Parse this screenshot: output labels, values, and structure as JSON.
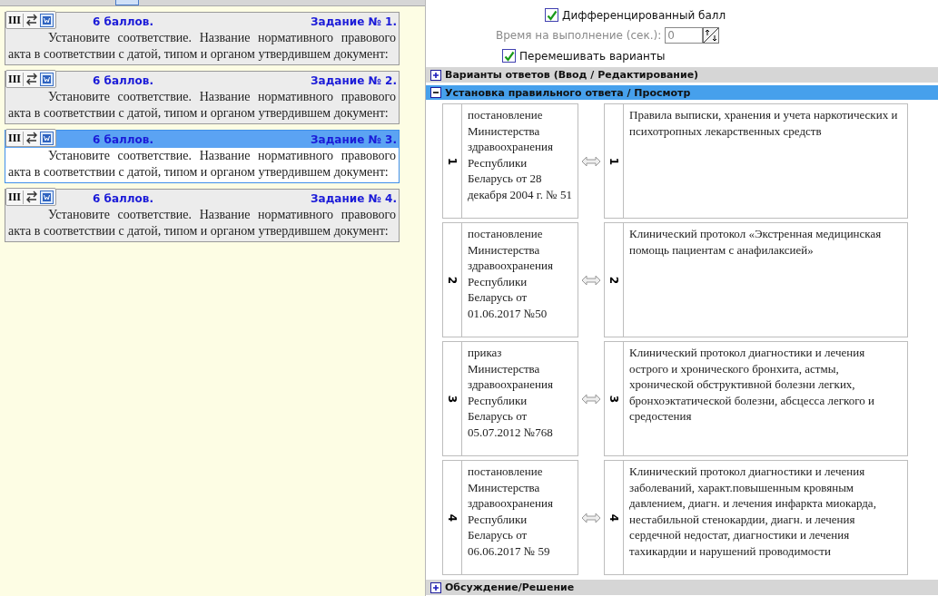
{
  "tasks": [
    {
      "tool_label": "III",
      "points": "6 баллов.",
      "title": "Задание № 1.",
      "text": "Установите соответствие. Название нормативного правового акта в соответствии с датой, типом и органом утвердившем документ:",
      "selected": false
    },
    {
      "tool_label": "III",
      "points": "6 баллов.",
      "title": "Задание № 2.",
      "text": "Установите соответствие. Название нормативного правового акта в соответствии с датой, типом и органом утвердившем документ:",
      "selected": false
    },
    {
      "tool_label": "III",
      "points": "6 баллов.",
      "title": "Задание № 3.",
      "text": "Установите соответствие. Название нормативного правового акта в соответствии с датой, типом и органом утвердившем документ:",
      "selected": true
    },
    {
      "tool_label": "III",
      "points": "6 баллов.",
      "title": "Задание № 4.",
      "text": "Установите соответствие. Название нормативного правового акта в соответствии с датой, типом и органом утвердившем документ:",
      "selected": false
    }
  ],
  "settings": {
    "differentiated": {
      "label": "Дифференцированный балл",
      "checked": true
    },
    "time": {
      "label": "Время на выполнение (сек.):",
      "value": "0"
    },
    "shuffle": {
      "label": "Перемешивать варианты",
      "checked": true
    }
  },
  "sections": [
    {
      "label": "Варианты ответов (Ввод / Редактирование)",
      "expanded": false,
      "selected": false
    },
    {
      "label": "Установка правильного ответа / Просмотр",
      "expanded": true,
      "selected": true,
      "pairs": [
        {
          "left_number": "1",
          "left": "постановление Министерства здравоохранения Республики Беларусь от 28 декабря 2004 г. № 51",
          "right_number": "1",
          "right": "Правила выписки, хранения и учета наркотических и психотропных лекарственных средств"
        },
        {
          "left_number": "2",
          "left": "постановление Министерства здравоохранения Республики Беларусь от 01.06.2017 №50",
          "right_number": "2",
          "right": "Клинический протокол «Экстренная медицинская помощь пациентам с анафилаксией»"
        },
        {
          "left_number": "3",
          "left": "приказ Министерства здравоохранения Республики Беларусь от 05.07.2012 №768",
          "right_number": "3",
          "right": "Клинический протокол диагностики и лечения острого и хронического бронхита, астмы, хронической обструктивной болезни легких, бронхоэктатической болезни, абсцесса легкого и средостения"
        },
        {
          "left_number": "4",
          "left": "постановление Министерства здравоохранения Республики Беларусь от 06.06.2017 № 59",
          "right_number": "4",
          "right": "Клинический протокол диагностики и лечения заболеваний, характ.повышенным кровяным давлением, диагн. и лечения инфаркта миокарда, нестабильной стенокардии, диагн. и лечения сердечной недостат, диагностики и лечения тахикардии и нарушений проводимости"
        }
      ]
    },
    {
      "label": "Обсуждение/Решение",
      "expanded": false,
      "selected": false
    }
  ]
}
